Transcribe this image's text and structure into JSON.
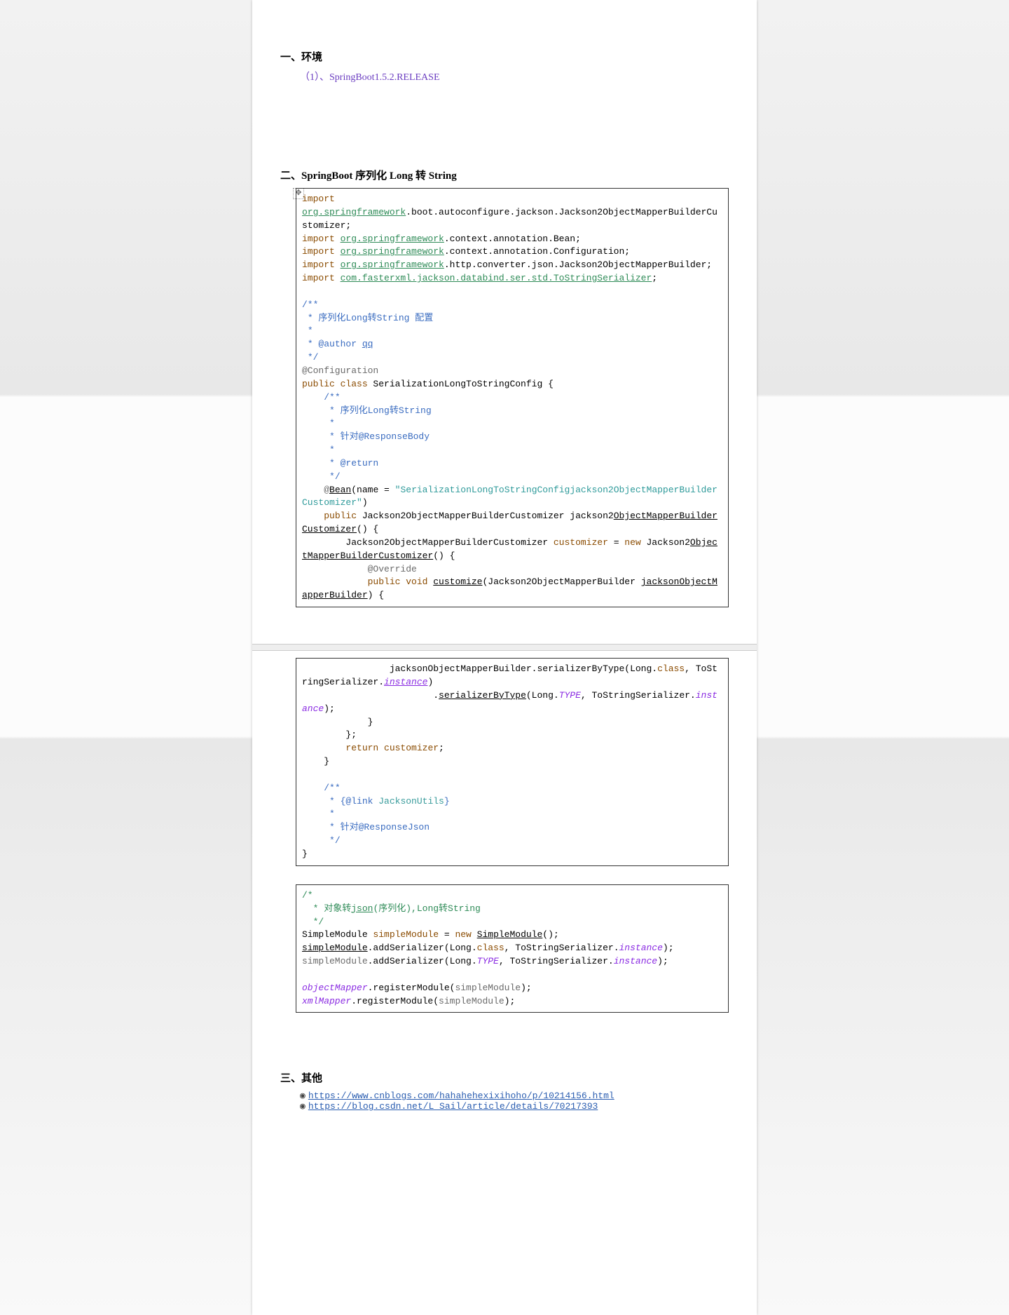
{
  "section1": {
    "title": "一、环境",
    "item1": "（1）、SpringBoot1.5.2.RELEASE"
  },
  "section2": {
    "title": "二、SpringBoot 序列化 Long 转 String"
  },
  "code1": {
    "l1_import": "import",
    "l1_pkg": "org.springframework",
    "l1_rest": ".boot.autoconfigure.jackson.Jackson2ObjectMapperBuilderCustomizer;",
    "l2_import": "import ",
    "l2_pkg": "org.springframework",
    "l2_rest": ".context.annotation.Bean;",
    "l3_import": "import ",
    "l3_pkg": "org.springframework",
    "l3_rest": ".context.annotation.Configuration;",
    "l4_import": "import ",
    "l4_pkg": "org.springframework",
    "l4_rest": ".http.converter.json.Jackson2ObjectMapperBuilder;",
    "l5_import": "import ",
    "l5_pkg": "com.fasterxml.jackson.databind.ser.std.ToStringSerializer",
    "l5_rest": ";",
    "c1": "/**",
    "c2": " * 序列化Long转String 配置",
    "c3": " *",
    "c4a": " * @author ",
    "c4b": "qq",
    "c5": " */",
    "ann1": "@Configuration",
    "cls1a": "public class",
    "cls1b": " SerializationLongToStringConfig {",
    "c6": "    /**",
    "c7": "     * 序列化Long转String",
    "c8": "     *",
    "c9": "     * 针对@ResponseBody",
    "c10": "     *",
    "c11": "     * @return",
    "c12": "     */",
    "ann2a": "    @",
    "ann2b": "Bean",
    "ann2c": "(name = ",
    "str1": "\"SerializationLongToStringConfigjackson2ObjectMapperBuilderCustomizer\"",
    "ann2d": ")",
    "m1a": "    public",
    "m1b": " Jackson2ObjectMapperBuilderCustomizer jackson2",
    "m1c": "ObjectMapperBuilderCustomizer",
    "m1d": "() {",
    "m2a": "        Jackson2ObjectMapperBuilderCustomizer ",
    "m2var": "customizer",
    "m2b": " = ",
    "m2new": "new",
    "m2c": " Jackson2",
    "m2d": "ObjectMapperBuilderCustomizer",
    "m2e": "() {",
    "m3": "            @Override",
    "m4a": "            public void ",
    "m4b": "customize",
    "m4c": "(Jackson2ObjectMapperBuilder ",
    "m4d": "jacksonObjectMapperBuilder",
    "m4e": ") {"
  },
  "code2": {
    "l1a": "                jacksonObjectMapperBuilder.serializerByType(Long.",
    "l1b": "class",
    "l1c": ", ToStringSerializer.",
    "l1d": "instance",
    "l1e": ")",
    "l2a": "                        .",
    "l2b": "serializerByType",
    "l2c": "(Long.",
    "l2d": "TYPE",
    "l2e": ", ToStringSerializer.",
    "l2f": "instance",
    "l2g": ");",
    "l3": "            }",
    "l4": "        };",
    "l5a": "        return ",
    "l5b": "customizer",
    "l5c": ";",
    "l6": "    }",
    "blank": "",
    "c1": "    /**",
    "c2a": "     * {@link ",
    "c2b": "JacksonUtils",
    "c2c": "}",
    "c3": "     *",
    "c4": "     * 针对@ResponseJson",
    "c5": "     */",
    "l7": "}"
  },
  "code3": {
    "c1": "/*",
    "c2a": "  * 对象转",
    "c2b": "json",
    "c2c": "(序列化),Long转String",
    "c3": "  */",
    "l1a": "SimpleModule ",
    "l1b": "simpleModule",
    "l1c": " = ",
    "l1d": "new",
    "l1e": " ",
    "l1f": "SimpleModule",
    "l1g": "();",
    "l2a": "simpleModule",
    "l2b": ".addSerializer(Long.",
    "l2c": "class",
    "l2d": ", ToStringSerializer.",
    "l2e": "instance",
    "l2f": ");",
    "l3a": "simpleModule",
    "l3b": ".addSerializer(Long.",
    "l3c": "TYPE",
    "l3d": ", ToStringSerializer.",
    "l3e": "instance",
    "l3f": ");",
    "blank": "",
    "l4a": "objectMapper",
    "l4b": ".registerModule(",
    "l4c": "simpleModule",
    "l4d": ");",
    "l5a": "xmlMapper",
    "l5b": ".registerModule(",
    "l5c": "simpleModule",
    "l5d": ");"
  },
  "section3": {
    "title": "三、其他",
    "bullet": "◉",
    "link1": "https://www.cnblogs.com/hahahehexixihoho/p/10214156.html",
    "link2": "https://blog.csdn.net/L_Sail/article/details/70217393"
  }
}
